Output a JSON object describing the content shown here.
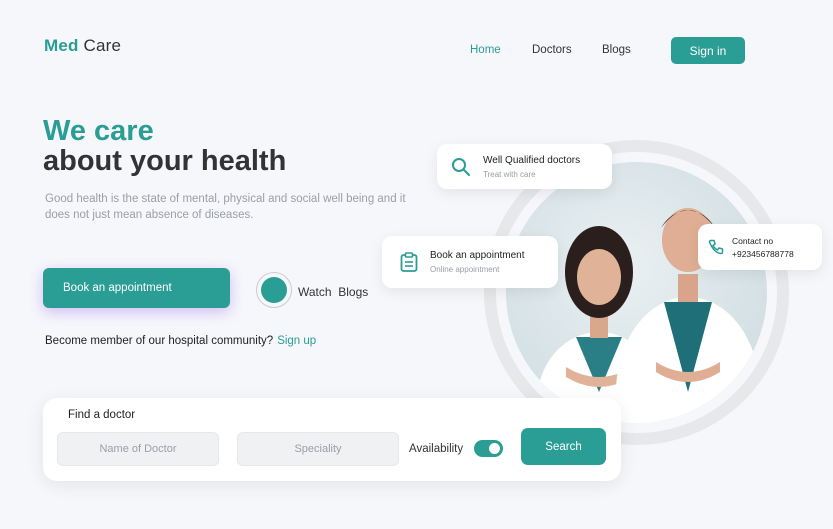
{
  "brand": {
    "first": "Med",
    "second": "Care"
  },
  "nav": {
    "items": [
      {
        "label": "Home",
        "active": true
      },
      {
        "label": "Doctors",
        "active": false
      },
      {
        "label": "Blogs",
        "active": false
      }
    ],
    "signin_label": "Sign in"
  },
  "hero": {
    "title_line1": "We care",
    "title_line2": "about your health",
    "description": "Good health is the state of mental, physical and social well being and it does not just mean absence of diseases.",
    "book_label": "Book an appointment",
    "watch_label": "Watch  Blogs",
    "member_text": "Become member of our hospital community?",
    "signup_label": "Sign up"
  },
  "cards": {
    "qualified": {
      "title": "Well Qualified doctors",
      "subtitle": "Treat with care",
      "icon": "search-icon"
    },
    "appointment": {
      "title": "Book an appointment",
      "subtitle": "Online appointment",
      "icon": "clipboard-icon"
    },
    "contact": {
      "title": "Contact no",
      "subtitle": "+923456788778",
      "icon": "phone-icon"
    }
  },
  "search": {
    "label": "Find a doctor",
    "name_placeholder": "Name of Doctor",
    "speciality_placeholder": "Speciality",
    "availability_label": "Availability",
    "availability_on": true,
    "button_label": "Search"
  },
  "colors": {
    "accent": "#2a9d94",
    "background": "#f6f7fb",
    "text": "#2f3237",
    "muted": "#9a9ea5"
  }
}
